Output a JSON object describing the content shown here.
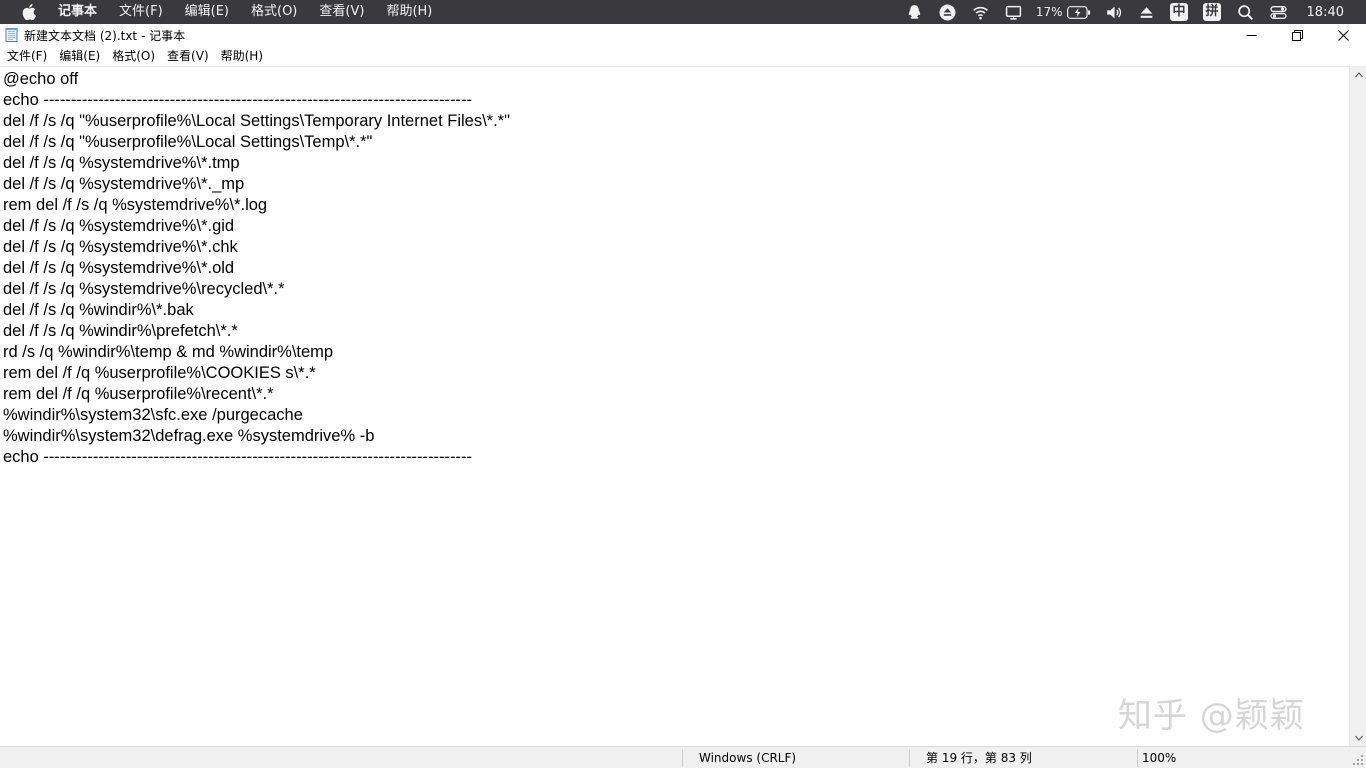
{
  "system_menubar": {
    "app_name": "记事本",
    "items": [
      "文件(F)",
      "编辑(E)",
      "格式(O)",
      "查看(V)",
      "帮助(H)"
    ],
    "battery_percent": "17%",
    "ime_label": "中",
    "ime_mode_label": "拼",
    "clock": "18:40"
  },
  "window": {
    "title": "新建文本文档 (2).txt - 记事本"
  },
  "app_menu": {
    "items": [
      "文件(F)",
      "编辑(E)",
      "格式(O)",
      "查看(V)",
      "帮助(H)"
    ]
  },
  "editor": {
    "lines": [
      "@echo off",
      "echo ------------------------------------------------------------------------------",
      "del /f /s /q \"%userprofile%\\Local Settings\\Temporary Internet Files\\*.*\"",
      "del /f /s /q \"%userprofile%\\Local Settings\\Temp\\*.*\"",
      "del /f /s /q %systemdrive%\\*.tmp",
      "del /f /s /q %systemdrive%\\*._mp",
      "rem del /f /s /q %systemdrive%\\*.log",
      "del /f /s /q %systemdrive%\\*.gid",
      "del /f /s /q %systemdrive%\\*.chk",
      "del /f /s /q %systemdrive%\\*.old",
      "del /f /s /q %systemdrive%\\recycled\\*.*",
      "del /f /s /q %windir%\\*.bak",
      "del /f /s /q %windir%\\prefetch\\*.*",
      "rd /s /q %windir%\\temp & md %windir%\\temp",
      "rem del /f /q %userprofile%\\COOKIES s\\*.*",
      "rem del /f /q %userprofile%\\recent\\*.*",
      "%windir%\\system32\\sfc.exe /purgecache",
      "%windir%\\system32\\defrag.exe %systemdrive% -b",
      "echo ------------------------------------------------------------------------------"
    ]
  },
  "statusbar": {
    "line_ending": "Windows (CRLF)",
    "cursor_position": "第 19 行，第 83 列",
    "zoom": "100%"
  },
  "watermark": {
    "text": "知乎 @颖颖"
  },
  "colors": {
    "menubar_bg": "#3a3a3c",
    "statusbar_bg": "#f0f0f0",
    "text": "#000000"
  }
}
